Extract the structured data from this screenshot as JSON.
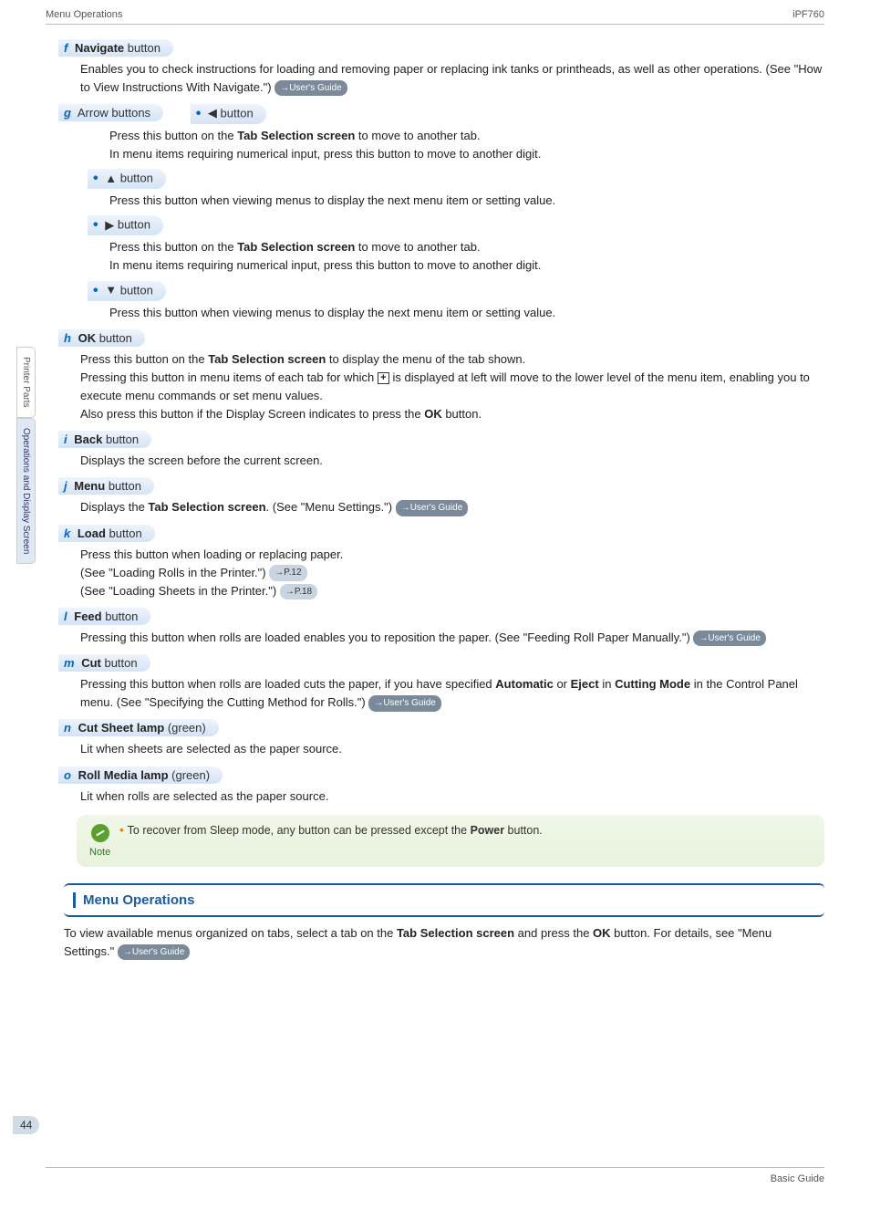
{
  "header": {
    "left": "Menu Operations",
    "right": "iPF760"
  },
  "sideTabs": {
    "a": "Printer Parts",
    "b": "Operations and Display Screen"
  },
  "items": {
    "f": {
      "letter": "f",
      "title_b": "Navigate",
      "title_r": " button",
      "desc": "Enables you to check instructions for loading and removing paper or replacing ink tanks or printheads, as well as other operations.  (See \"How to View Instructions With Navigate.\") ",
      "badge": "→User's Guide"
    },
    "g": {
      "letter": "g",
      "title_r": " Arrow buttons",
      "sub": {
        "left": {
          "glyph": "◀",
          "label": " button",
          "l1a": "Press this button on the ",
          "l1b": "Tab Selection screen",
          "l1c": " to move to another tab.",
          "l2": "In menu items requiring numerical input, press this button to move to another digit."
        },
        "up": {
          "glyph": "▲",
          "label": " button",
          "l1": "Press this button when viewing menus to display the next menu item or setting value."
        },
        "right": {
          "glyph": "▶",
          "label": " button",
          "l1a": "Press this button on the ",
          "l1b": "Tab Selection screen",
          "l1c": " to move to another tab.",
          "l2": "In menu items requiring numerical input, press this button to move to another digit."
        },
        "down": {
          "glyph": "▼",
          "label": " button",
          "l1": "Press this button when viewing menus to display the next menu item or setting value."
        }
      }
    },
    "h": {
      "letter": "h",
      "title_b": "OK",
      "title_r": " button",
      "l1a": "Press this button on the ",
      "l1b": "Tab Selection screen",
      "l1c": " to display the menu of the tab shown.",
      "l2a": "Pressing this button in menu items of each tab for which ",
      "l2_plus": "+",
      "l2b": " is displayed at left will move to the lower level of the menu item, enabling you to execute menu commands or set menu values.",
      "l3a": "Also press this button if the Display Screen indicates to press the ",
      "l3b": "OK",
      "l3c": " button."
    },
    "i": {
      "letter": "i",
      "title_b": "Back",
      "title_r": " button",
      "l1": "Displays the screen before the current screen."
    },
    "j": {
      "letter": "j",
      "title_b": "Menu",
      "title_r": " button",
      "l1a": "Displays the ",
      "l1b": "Tab Selection screen",
      "l1c": ".  (See \"Menu Settings.\") ",
      "badge": "→User's Guide"
    },
    "k": {
      "letter": "k",
      "title_b": "Load",
      "title_r": " button",
      "l1": "Press this button when loading or replacing paper.",
      "l2": " (See \"Loading Rolls in the Printer.\") ",
      "badge2": "→P.12",
      "l3": " (See \"Loading Sheets in the Printer.\") ",
      "badge3": "→P.18"
    },
    "l": {
      "letter": "l",
      "title_b": "Feed",
      "title_r": " button",
      "l1": "Pressing this button when rolls are loaded enables you to reposition the paper.  (See \"Feeding Roll Paper Manually.\") ",
      "badge": "→User's Guide"
    },
    "m": {
      "letter": "m",
      "title_b": "Cut",
      "title_r": " button",
      "l1a": "Pressing this button when rolls are loaded cuts the paper, if you have specified ",
      "l1b": "Automatic",
      "l1c": " or ",
      "l1d": "Eject",
      "l1e": " in ",
      "l1f": "Cutting Mode",
      "l1g": " in the Control Panel menu.  (See \"Specifying the Cutting Method for Rolls.\") ",
      "badge": "→User's Guide"
    },
    "n": {
      "letter": "n",
      "title_b": "Cut Sheet lamp",
      "title_r": " (green)",
      "l1": "Lit when sheets are selected as the paper source."
    },
    "o": {
      "letter": "o",
      "title_b": "Roll Media lamp",
      "title_r": " (green)",
      "l1": "Lit when rolls are selected as the paper source."
    }
  },
  "note": {
    "label": "Note",
    "text_a": "To recover from Sleep mode, any button can be pressed except the ",
    "text_b": "Power",
    "text_c": " button."
  },
  "section": {
    "title": "Menu Operations",
    "body_a": "To view available menus organized on tabs, select a tab on the ",
    "body_b": "Tab Selection screen",
    "body_c": " and press the ",
    "body_d": "OK",
    "body_e": " button. For details, see \"Menu Settings.\" ",
    "badge": "→User's Guide"
  },
  "pageNum": "44",
  "footer": "Basic Guide"
}
